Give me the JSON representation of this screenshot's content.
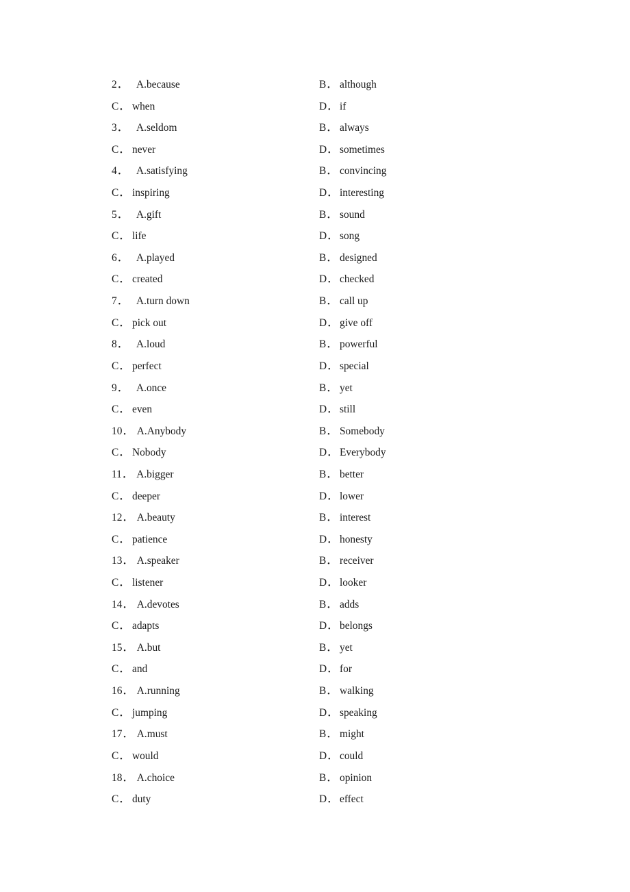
{
  "document": {
    "type": "cloze-test-answer-options",
    "page_background": "#ffffff",
    "text_color": "#1a1a1a"
  },
  "questions": [
    {
      "number": "2．",
      "a_label": "A.because",
      "b_marker": "B．",
      "b_text": "although",
      "c_marker": "C．",
      "c_text": "when",
      "d_marker": "D．",
      "d_text": "if"
    },
    {
      "number": "3．",
      "a_label": "A.seldom",
      "b_marker": "B．",
      "b_text": "always",
      "c_marker": "C．",
      "c_text": "never",
      "d_marker": "D．",
      "d_text": "sometimes"
    },
    {
      "number": "4．",
      "a_label": "A.satisfying",
      "b_marker": "B．",
      "b_text": "convincing",
      "c_marker": "C．",
      "c_text": "inspiring",
      "d_marker": "D．",
      "d_text": "interesting"
    },
    {
      "number": "5．",
      "a_label": "A.gift",
      "b_marker": "B．",
      "b_text": "sound",
      "c_marker": "C．",
      "c_text": "life",
      "d_marker": "D．",
      "d_text": "song"
    },
    {
      "number": "6．",
      "a_label": "A.played",
      "b_marker": "B．",
      "b_text": "designed",
      "c_marker": "C．",
      "c_text": "created",
      "d_marker": "D．",
      "d_text": "checked"
    },
    {
      "number": "7．",
      "a_label": "A.turn down",
      "b_marker": "B．",
      "b_text": "call up",
      "c_marker": "C．",
      "c_text": "pick out",
      "d_marker": "D．",
      "d_text": "give off"
    },
    {
      "number": "8．",
      "a_label": "A.loud",
      "b_marker": "B．",
      "b_text": "powerful",
      "c_marker": "C．",
      "c_text": "perfect",
      "d_marker": "D．",
      "d_text": "special"
    },
    {
      "number": "9．",
      "a_label": "A.once",
      "b_marker": "B．",
      "b_text": "yet",
      "c_marker": "C．",
      "c_text": "even",
      "d_marker": "D．",
      "d_text": "still"
    },
    {
      "number": "10．",
      "a_label": "A.Anybody",
      "b_marker": "B．",
      "b_text": "Somebody",
      "c_marker": "C．",
      "c_text": "Nobody",
      "d_marker": "D．",
      "d_text": "Everybody"
    },
    {
      "number": "11．",
      "a_label": "A.bigger",
      "b_marker": "B．",
      "b_text": "better",
      "c_marker": "C．",
      "c_text": "deeper",
      "d_marker": "D．",
      "d_text": "lower"
    },
    {
      "number": "12．",
      "a_label": "A.beauty",
      "b_marker": "B．",
      "b_text": "interest",
      "c_marker": "C．",
      "c_text": "patience",
      "d_marker": "D．",
      "d_text": "honesty"
    },
    {
      "number": "13．",
      "a_label": "A.speaker",
      "b_marker": "B．",
      "b_text": "receiver",
      "c_marker": "C．",
      "c_text": "listener",
      "d_marker": "D．",
      "d_text": "looker"
    },
    {
      "number": "14．",
      "a_label": "A.devotes",
      "b_marker": "B．",
      "b_text": "adds",
      "c_marker": "C．",
      "c_text": "adapts",
      "d_marker": "D．",
      "d_text": "belongs"
    },
    {
      "number": "15．",
      "a_label": "A.but",
      "b_marker": "B．",
      "b_text": "yet",
      "c_marker": "C．",
      "c_text": "and",
      "d_marker": "D．",
      "d_text": "for"
    },
    {
      "number": "16．",
      "a_label": "A.running",
      "b_marker": "B．",
      "b_text": "walking",
      "c_marker": "C．",
      "c_text": "jumping",
      "d_marker": "D．",
      "d_text": "speaking"
    },
    {
      "number": "17．",
      "a_label": "A.must",
      "b_marker": "B．",
      "b_text": "might",
      "c_marker": "C．",
      "c_text": "would",
      "d_marker": "D．",
      "d_text": "could"
    },
    {
      "number": "18．",
      "a_label": "A.choice",
      "b_marker": "B．",
      "b_text": "opinion",
      "c_marker": "C．",
      "c_text": "duty",
      "d_marker": "D．",
      "d_text": "effect"
    }
  ]
}
